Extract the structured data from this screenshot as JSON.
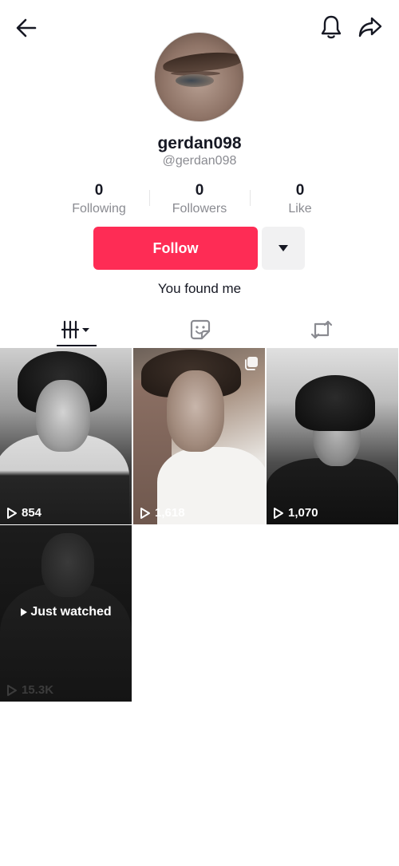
{
  "profile": {
    "username": "gerdan098",
    "handle": "@gerdan098",
    "bio": "You found me"
  },
  "stats": {
    "following": {
      "value": "0",
      "label": "Following"
    },
    "followers": {
      "value": "0",
      "label": "Followers"
    },
    "likes": {
      "value": "0",
      "label": "Like"
    }
  },
  "actions": {
    "follow_label": "Follow"
  },
  "tabs": [
    {
      "name": "videos",
      "icon": "videos-grid-icon",
      "active": true
    },
    {
      "name": "liked",
      "icon": "sticker-icon",
      "active": false
    },
    {
      "name": "reposts",
      "icon": "repost-icon",
      "active": false
    }
  ],
  "videos": [
    {
      "views": "854"
    },
    {
      "views": "1,618",
      "multi": true
    },
    {
      "views": "1,070"
    },
    {
      "views": "15.3K",
      "overlay": "Just watched"
    }
  ],
  "colors": {
    "accent": "#fe2c55",
    "text": "#161823",
    "muted": "#8a8b91"
  }
}
